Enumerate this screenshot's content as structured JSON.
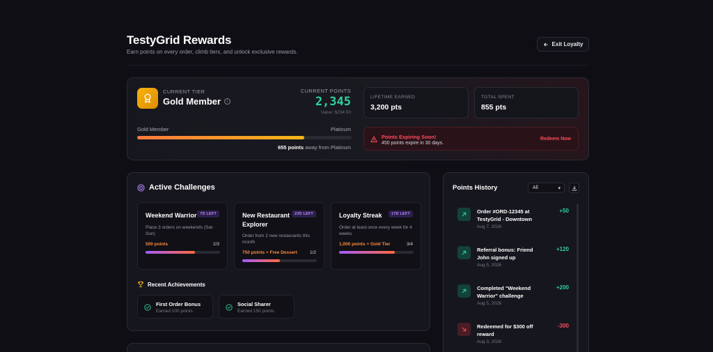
{
  "header": {
    "title": "TestyGrid Rewards",
    "subtitle": "Earn points on every order, climb tiers, and unlock exclusive rewards.",
    "exit_label": "Exit Loyalty"
  },
  "tier": {
    "label": "CURRENT TIER",
    "name": "Gold Member",
    "points_label": "CURRENT POINTS",
    "points_value": "2,345",
    "points_sub": "Value: $234.50",
    "progress_from": "Gold Member",
    "progress_to": "Platinum",
    "progress_fraction": 0.78,
    "away_points": "655 points",
    "away_text": "away from Platinum"
  },
  "stats": {
    "lifetime_label": "LIFETIME EARNED",
    "lifetime_value": "3,200 pts",
    "spent_label": "TOTAL SPENT",
    "spent_value": "855 pts"
  },
  "expiring": {
    "title": "Points Expiring Soon!",
    "sub": "450 points expire in 30 days.",
    "action": "Redeem Now"
  },
  "challenges": {
    "title": "Active Challenges",
    "items": [
      {
        "name": "Weekend Warrior",
        "badge": "7D LEFT",
        "desc": "Place 3 orders on weekends (Sat-Sun)",
        "reward": "500 points",
        "count": "2/3",
        "fraction": 0.667
      },
      {
        "name": "New Restaurant Explorer",
        "badge": "23D LEFT",
        "desc": "Order from 2 new restaurants this month",
        "reward": "750 points + Free Dessert",
        "count": "1/2",
        "fraction": 0.5
      },
      {
        "name": "Loyalty Streak",
        "badge": "17D LEFT",
        "desc": "Order at least once every week for 4 weeks",
        "reward": "1,000 points + Gold Tier",
        "count": "3/4",
        "fraction": 0.75
      }
    ]
  },
  "achievements": {
    "title": "Recent Achievements",
    "items": [
      {
        "name": "First Order Bonus",
        "sub": "Earned 100 points"
      },
      {
        "name": "Social Sharer",
        "sub": "Earned 150 points"
      }
    ]
  },
  "history": {
    "title": "Points History",
    "filter": "All",
    "items": [
      {
        "desc": "Order #ORD-12345 at TestyGrid - Downtown",
        "date": "Aug 7, 2026",
        "amount": "+50",
        "kind": "earn"
      },
      {
        "desc": "Referral bonus: Friend John signed up",
        "date": "Aug 5, 2026",
        "amount": "+120",
        "kind": "earn"
      },
      {
        "desc": "Completed \"Weekend Warrior\" challenge",
        "date": "Aug 5, 2026",
        "amount": "+200",
        "kind": "earn"
      },
      {
        "desc": "Redeemed for $300 off reward",
        "date": "Aug 3, 2026",
        "amount": "-300",
        "kind": "spend"
      }
    ]
  },
  "colors": {
    "earn": "#2fd39b",
    "spend": "#ff4b5c",
    "gold": "#f6b40f",
    "accent_purple": "#a35bff"
  }
}
